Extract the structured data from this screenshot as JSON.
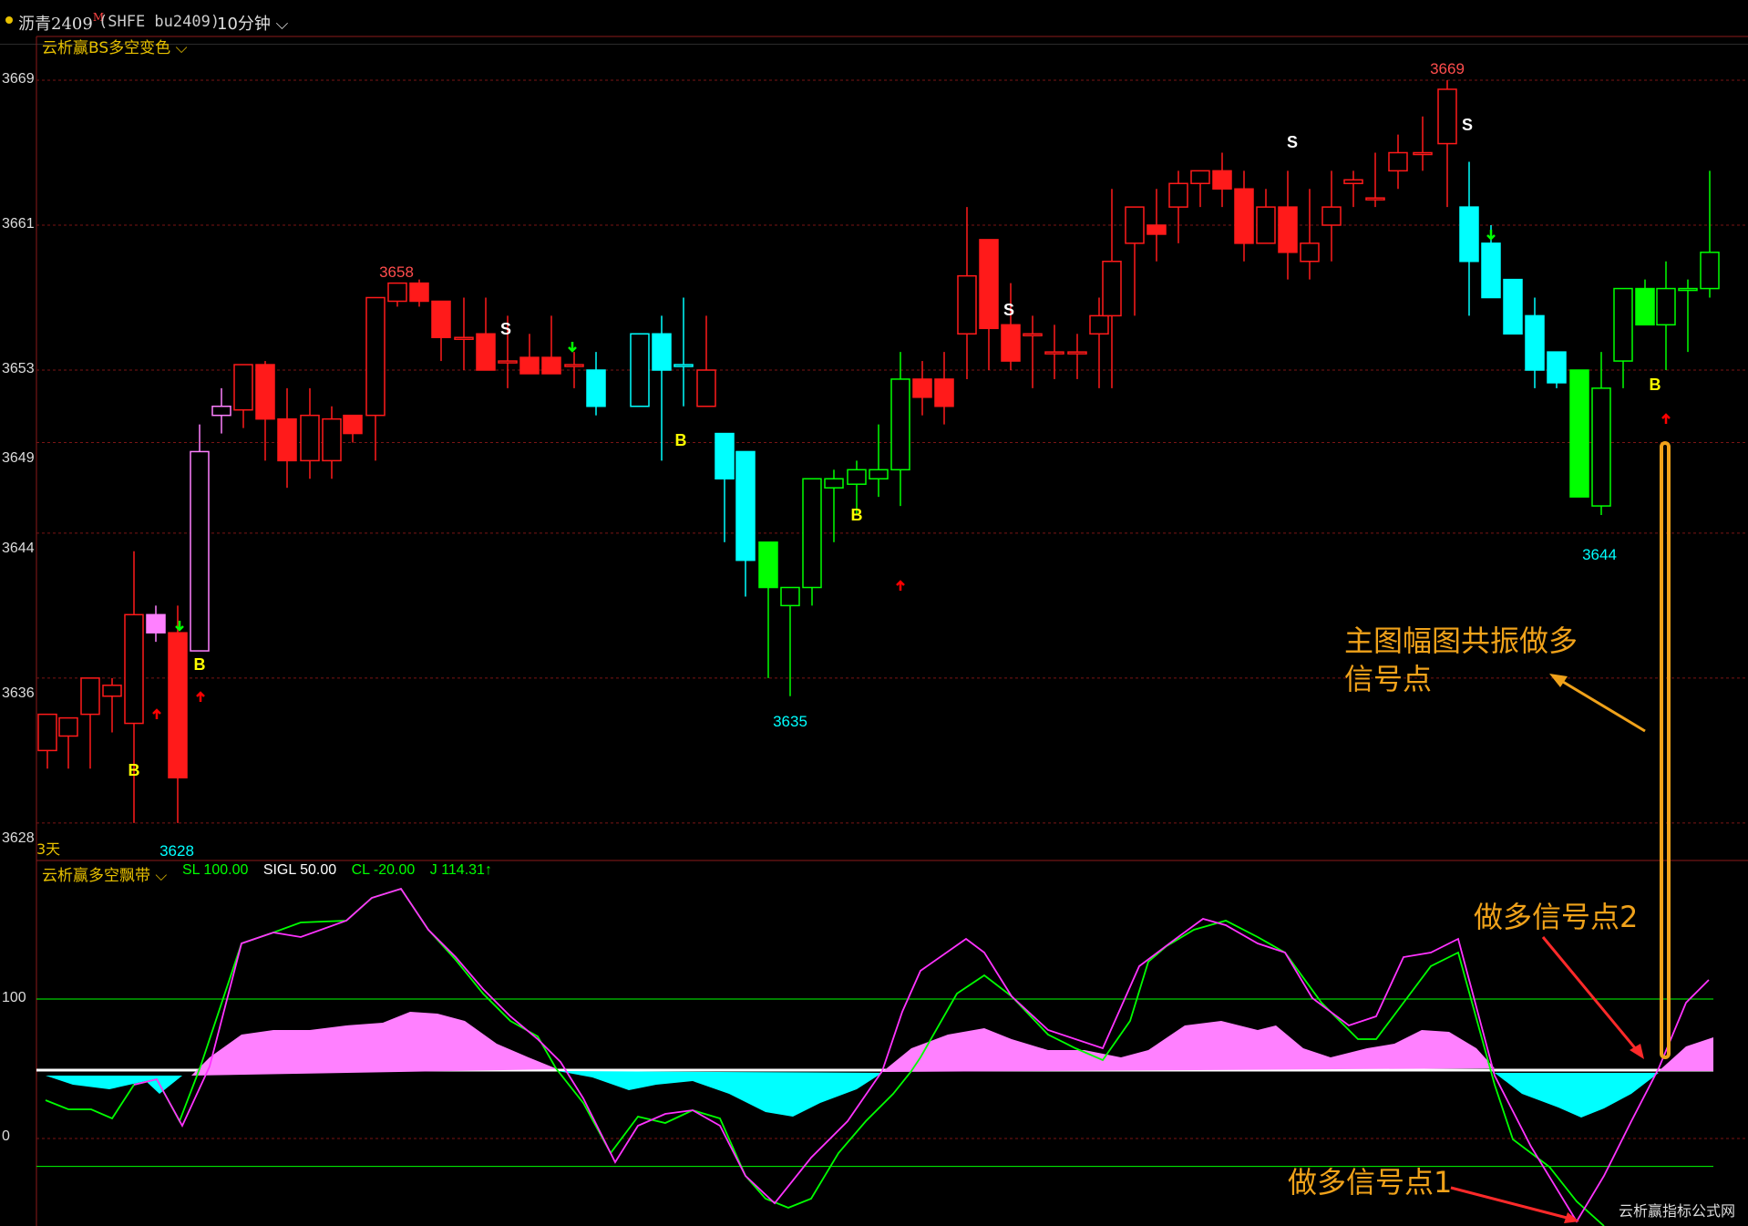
{
  "header": {
    "instrument": "沥青2409",
    "instrument_flag": "M",
    "code": "(SHFE bu2409)",
    "period": "10分钟"
  },
  "main_panel": {
    "indicator": "云析赢BS多空变色",
    "y_ticks": [
      "3669",
      "3661",
      "3653",
      "3649",
      "3644",
      "3636",
      "3628"
    ],
    "range_label": "3天"
  },
  "sub_panel": {
    "indicator": "云析赢多空飘带",
    "params": [
      {
        "label": "SL 100.00",
        "color": "#00ff00"
      },
      {
        "label": "SIGL 50.00",
        "color": "#ffffff"
      },
      {
        "label": "CL -20.00",
        "color": "#00ff00"
      },
      {
        "label": "J 114.31↑",
        "color": "#00ff00"
      }
    ],
    "y_ticks": [
      "100",
      "0"
    ]
  },
  "annotations": {
    "main_note_line1": "主图幅图共振做多",
    "main_note_line2": "信号点",
    "signal2": "做多信号点2",
    "signal1": "做多信号点1"
  },
  "price_labels": [
    "3669",
    "3658",
    "3628",
    "3635",
    "3644"
  ],
  "signal_labels": {
    "buy": "B",
    "sell": "S"
  },
  "watermark": "云析赢指标公式网",
  "colors": {
    "up_red": "#ff1a1a",
    "down_red": "#ff0000",
    "cyan": "#00ffff",
    "green": "#00ff00",
    "pink": "#ff80ff",
    "yellow": "#ffff00",
    "orange": "#f0a21a"
  }
}
